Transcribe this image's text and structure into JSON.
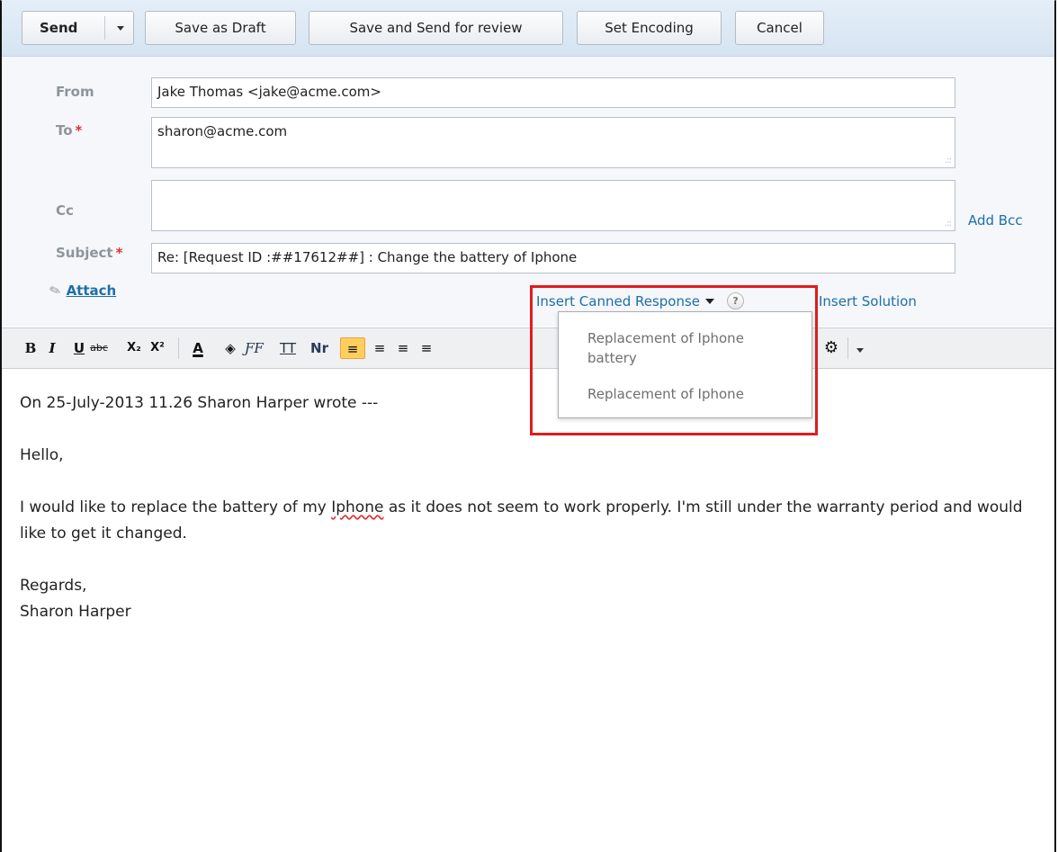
{
  "toolbar": {
    "send": "Send",
    "save_draft": "Save as Draft",
    "save_review": "Save and Send for review",
    "set_encoding": "Set Encoding",
    "cancel": "Cancel"
  },
  "form": {
    "from_label": "From",
    "from_value": "Jake Thomas <jake@acme.com>",
    "to_label": "To",
    "to_value": "sharon@acme.com",
    "cc_label": "Cc",
    "cc_value": "",
    "add_bcc": "Add Bcc",
    "subject_label": "Subject",
    "subject_value": "Re: [Request ID :##17612##] : Change the battery of Iphone",
    "required_mark": "*",
    "attach": "Attach"
  },
  "canned": {
    "label": "Insert Canned Response",
    "help": "?",
    "insert_solution": "Insert Solution",
    "items": [
      "Replacement of Iphone battery",
      "Replacement of Iphone"
    ]
  },
  "editor_toolbar": {
    "bold": "B",
    "italic": "I",
    "underline": "U",
    "strike": "abc",
    "subscript": "X₂",
    "superscript": "X²",
    "font_color": "A",
    "nr": "Nr"
  },
  "body": {
    "line1": "On 25-July-2013 11.26 Sharon Harper wrote ---",
    "greeting": "Hello,",
    "para_pre": "I would like to replace the battery of my ",
    "para_misspelled": "Iphone",
    "para_post": " as it does not seem to work properly. I'm still under the warranty period and would like to get it changed.",
    "regards": "Regards,",
    "signature": "Sharon Harper"
  }
}
